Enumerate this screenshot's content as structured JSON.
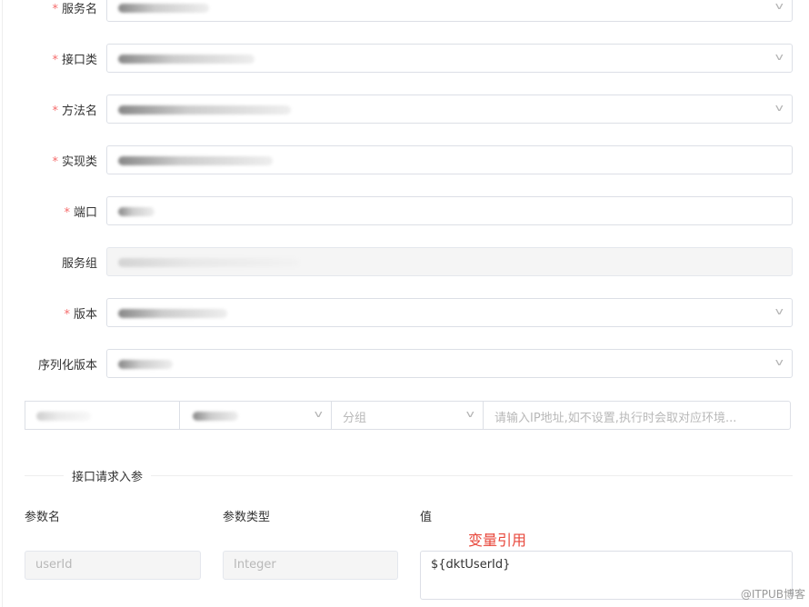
{
  "form": {
    "fields": [
      {
        "label": "服务名",
        "required": true,
        "type": "select"
      },
      {
        "label": "接口类",
        "required": true,
        "type": "select"
      },
      {
        "label": "方法名",
        "required": true,
        "type": "select"
      },
      {
        "label": "实现类",
        "required": true,
        "type": "input"
      },
      {
        "label": "端口",
        "required": true,
        "type": "input"
      },
      {
        "label": "服务组",
        "required": false,
        "type": "disabled"
      },
      {
        "label": "版本",
        "required": true,
        "type": "select"
      },
      {
        "label": "序列化版本",
        "required": false,
        "type": "select"
      }
    ],
    "required_mark": "*",
    "group_placeholder": "分组",
    "ip_placeholder": "请输入IP地址,如不设置,执行时会取对应环境..."
  },
  "params": {
    "section_title": "接口请求入参",
    "headers": {
      "name": "参数名",
      "type": "参数类型",
      "value": "值"
    },
    "annotation": "变量引用",
    "row": {
      "name": "userId",
      "type": "Integer",
      "value": "${dktUserId}"
    }
  },
  "watermark": "@ITPUB博客",
  "colors": {
    "required": "#f56c6c",
    "annotation": "#e8473b"
  }
}
